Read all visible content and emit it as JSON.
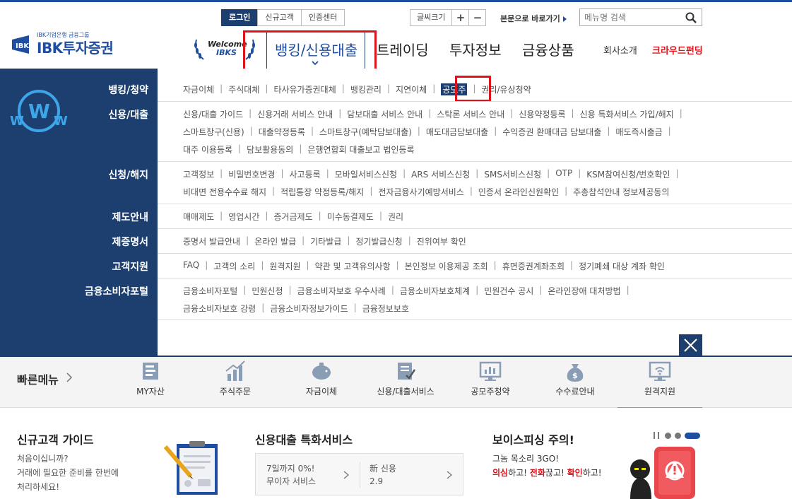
{
  "util": {
    "login": "로그인",
    "new_customer": "신규고객",
    "cert_center": "인증센터",
    "font_size": "글씨크기",
    "plus": "+",
    "minus": "−",
    "skip_to_content": "본문으로 바로가기",
    "search_placeholder": "메뉴명 검색"
  },
  "logo": {
    "subtitle": "IBK기업은행 금융그룹",
    "name": "IBK투자증권"
  },
  "welcome": {
    "line1": "Welcome",
    "line2": "IBKS"
  },
  "gnb": {
    "active": "뱅킹/신용대출",
    "items": [
      "트레이딩",
      "투자정보",
      "금융상품"
    ],
    "company": "회사소개",
    "crowdfunding": "크라우드펀딩"
  },
  "menu": {
    "categories": [
      "뱅킹/청약",
      "신용/대출",
      "신청/해지",
      "제도안내",
      "제증명서",
      "고객지원",
      "금융소비자포털"
    ],
    "banking": [
      "자금이체",
      "주식대체",
      "타사유가증권대체",
      "뱅킹관리",
      "지연이체",
      "공모주",
      "권리/유상청약"
    ],
    "credit_1": [
      "신용/대출 가이드",
      "신용거래 서비스 안내",
      "담보대출 서비스 안내",
      "스탁론 서비스 안내",
      "신용약정등록",
      "신용 특화서비스 가입/해지"
    ],
    "credit_2": [
      "스마트창구(신용)",
      "대출약정등록",
      "스마트창구(예탁담보대출)",
      "매도대금담보대출",
      "수익증권 환매대금 담보대출",
      "매도즉시출금"
    ],
    "credit_3": [
      "대주 이용등록",
      "담보활용동의",
      "은행연합회 대출보고 법인등록"
    ],
    "apply_1": [
      "고객정보",
      "비밀번호변경",
      "사고등록",
      "모바일서비스신청",
      "ARS 서비스신청",
      "SMS서비스신청",
      "OTP",
      "KSM참여신청/번호확인"
    ],
    "apply_2": [
      "비대면 전용수수료 해지",
      "적립통장 약정등록/해지",
      "전자금융사기예방서비스",
      "인증서 온라인신원확인",
      "주총참석안내 정보제공동의"
    ],
    "system": [
      "매매제도",
      "영업시간",
      "증거금제도",
      "미수동결제도",
      "권리"
    ],
    "cert": [
      "증명서 발급안내",
      "온라인 발급",
      "기타발급",
      "정기발급신청",
      "진위여부 확인"
    ],
    "support": [
      "FAQ",
      "고객의 소리",
      "원격지원",
      "약관 및 고객유의사항",
      "본인정보 이용제공 조회",
      "휴면증권계좌조회",
      "정기폐쇄 대상 계좌 확인"
    ],
    "portal_1": [
      "금융소비자포털",
      "민원신청",
      "금융소비자보호 우수사례",
      "금융소비자보호체계",
      "민원건수 공시",
      "온라인장애 대처방법"
    ],
    "portal_2": [
      "금융소비자보호 강령",
      "금융소비자정보가이드",
      "금융정보보호"
    ]
  },
  "quick": {
    "title": "빠른메뉴",
    "items": [
      "MY자산",
      "주식주문",
      "자금이체",
      "신용/대출서비스",
      "공모주청약",
      "수수료안내",
      "원격지원"
    ]
  },
  "bottom": {
    "guide_title": "신규고객 가이드",
    "guide_desc": [
      "처음이십니까?",
      "거래에 필요한 준비를 한번에",
      "처리하세요!"
    ],
    "svc_title": "신용대출 특화서비스",
    "svc1": [
      "7일까지 0%!",
      "무이자 서비스"
    ],
    "svc2": [
      "新 신용",
      "2.9"
    ],
    "voice_title": "보이스피싱 주의!",
    "voice_line1": "그놈 목소리 3GO!",
    "voice_w1": "의심",
    "voice_t1": "하고! ",
    "voice_w2": "전화",
    "voice_t2": "끊고! ",
    "voice_w3": "확인",
    "voice_t3": "하고!"
  },
  "colors": {
    "navy": "#1d3f6f",
    "brand": "#1f4ea1",
    "highlight_red": "#d9141b"
  }
}
